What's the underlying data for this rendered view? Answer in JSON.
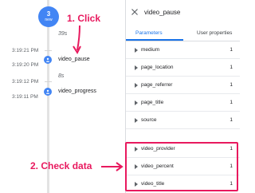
{
  "timeline": {
    "badge_count": "3",
    "badge_label": "new",
    "gap_top": "39s",
    "gap_middle": "8s",
    "events": [
      {
        "time": "3:19:21 PM",
        "name": ""
      },
      {
        "time": "3:19:20 PM",
        "name": "video_pause"
      },
      {
        "time": "3:19:12 PM",
        "name": ""
      },
      {
        "time": "3:19:11 PM",
        "name": "video_progress"
      }
    ]
  },
  "panel": {
    "title": "video_pause",
    "tabs": [
      {
        "label": "Parameters",
        "active": true
      },
      {
        "label": "User properties",
        "active": false
      }
    ],
    "params": [
      {
        "name": "medium",
        "count": "1"
      },
      {
        "name": "page_location",
        "count": "1"
      },
      {
        "name": "page_referrer",
        "count": "1"
      },
      {
        "name": "page_title",
        "count": "1"
      },
      {
        "name": "source",
        "count": "1"
      },
      {
        "name": "video_provider",
        "count": "1"
      },
      {
        "name": "video_percent",
        "count": "1"
      },
      {
        "name": "video_title",
        "count": "1"
      }
    ]
  },
  "annotations": {
    "step1": "1. Click",
    "step2": "2. Check data",
    "accent_color": "#e8195e"
  },
  "colors": {
    "primary": "#4285f4",
    "tab_active": "#1a73e8"
  }
}
